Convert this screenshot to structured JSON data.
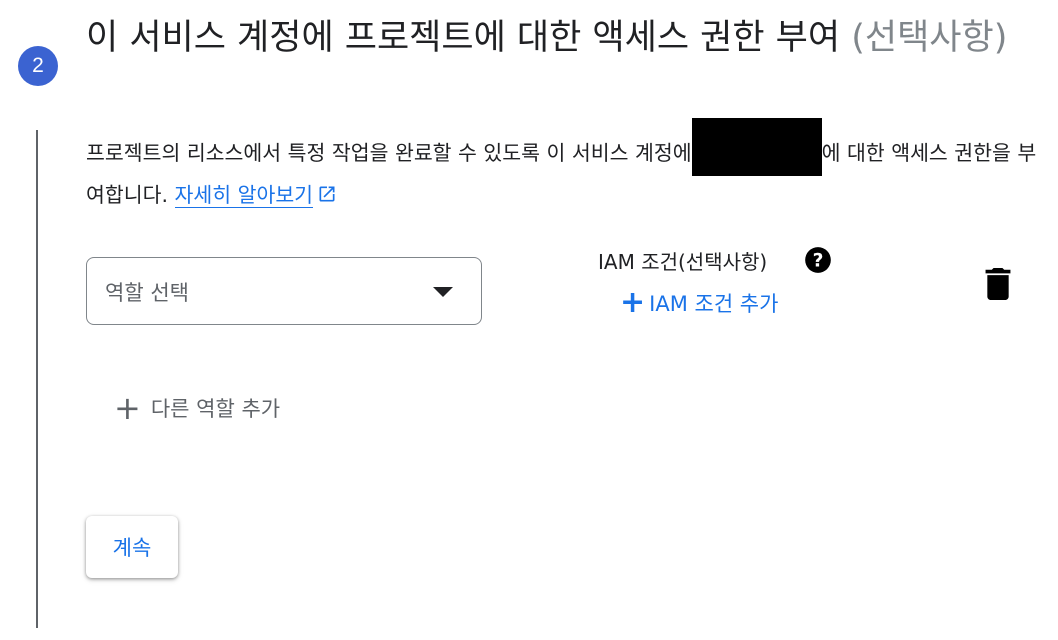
{
  "step": {
    "number": "2"
  },
  "header": {
    "title": "이 서비스 계정에 프로젝트에 대한 액세스 권한 부여",
    "optional": "(선택사항)"
  },
  "description": {
    "text_before": "프로젝트의 리소스에서 특정 작업을 완료할 수 있도록 이 서비스 계정에",
    "text_after": "에 대한 액세스 권한을 부여합니다.",
    "learn_more": "자세히 알아보기"
  },
  "role_select": {
    "placeholder": "역할 선택"
  },
  "iam_condition": {
    "label": "IAM 조건(선택사항)",
    "add_label": "IAM 조건 추가"
  },
  "add_role": {
    "label": "다른 역할 추가"
  },
  "continue_button": {
    "label": "계속"
  },
  "colors": {
    "accent": "#1a73e8",
    "badge": "#3b63d1",
    "optional_text": "#80868b"
  },
  "icons": [
    "help-icon",
    "trash-icon",
    "external-link-icon",
    "plus-icon",
    "caret-down-icon"
  ]
}
